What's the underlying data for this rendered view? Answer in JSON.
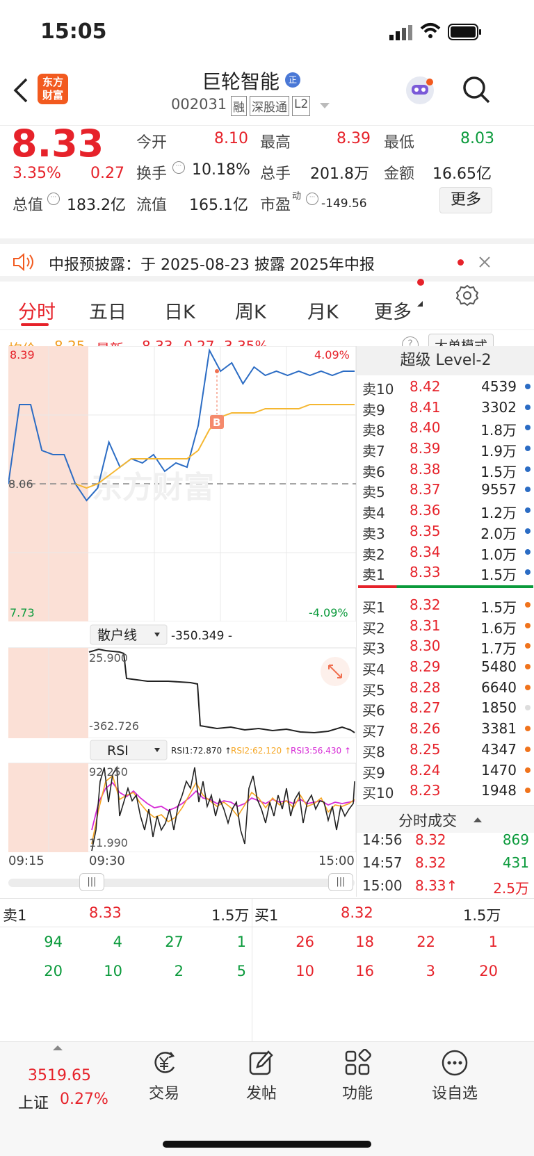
{
  "status": {
    "time": "15:05"
  },
  "header": {
    "logo_line1": "东方",
    "logo_line2": "财富",
    "stock_name": "巨轮智能",
    "stock_code": "002031",
    "tags": [
      "融",
      "深股通",
      "L2"
    ]
  },
  "quote": {
    "price": "8.33",
    "change_pct": "3.35%",
    "change": "0.27",
    "open_label": "今开",
    "open": "8.10",
    "high_label": "最高",
    "high": "8.39",
    "low_label": "最低",
    "low": "8.03",
    "turnover_label": "换手",
    "turnover": "10.18%",
    "volume_label": "总手",
    "volume": "201.8万",
    "amount_label": "金额",
    "amount": "16.65亿",
    "mktcap_label": "总值",
    "mktcap": "183.2亿",
    "float_label": "流值",
    "float": "165.1亿",
    "pe_label": "市盈",
    "pe_sup": "动",
    "pe": "-149.56",
    "more_button": "更多"
  },
  "notice": {
    "text": "中报预披露：于 2025-08-23 披露 2025年中报"
  },
  "tabs": [
    "分时",
    "五日",
    "日K",
    "周K",
    "月K",
    "更多"
  ],
  "info": {
    "avg_label": "均价:",
    "avg": "8.25",
    "latest_label": "最新:",
    "latest": "8.33",
    "latest_chg": "0.27",
    "latest_pct": "3.35%",
    "mode_button": "大单模式"
  },
  "chart": {
    "top_price": "8.39",
    "bottom_price": "7.73",
    "pre_close": "8.06",
    "top_pct": "4.09%",
    "bottom_pct": "-4.09%",
    "watermark": "东方财富",
    "buy_marker": "B",
    "retail_label": "散户线",
    "retail_value": "-350.349 -",
    "retail_top": "25.900",
    "retail_bottom": "-362.726",
    "rsi_label": "RSI",
    "rsi1": "RSI1:72.870 ↑",
    "rsi2": "RSI2:62.120 ↑",
    "rsi3": "RSI3:56.430 ↑",
    "rsi_top": "92.250",
    "rsi_bottom": "11.990",
    "time_start": "09:15",
    "time_open": "09:30",
    "time_end": "15:00"
  },
  "chart_data": {
    "type": "line",
    "title": "",
    "xlabel": "",
    "ylabel": "",
    "x_ticks": [
      "09:15",
      "09:30",
      "15:00"
    ],
    "ylim": [
      7.73,
      8.39
    ],
    "pre_close": 8.06,
    "series": [
      {
        "name": "",
        "values": [
          8.06,
          8.25,
          8.25,
          8.14,
          8.13,
          8.13,
          8.06,
          8.02,
          8.05,
          8.16,
          8.1,
          8.12,
          8.11,
          8.13,
          8.09,
          8.11,
          8.1,
          8.2,
          8.38,
          8.33,
          8.35,
          8.3,
          8.34,
          8.32,
          8.33,
          8.32,
          8.33,
          8.32,
          8.33,
          8.32,
          8.33,
          8.33
        ]
      },
      {
        "name": "均价",
        "values": [
          null,
          null,
          null,
          null,
          null,
          null,
          8.06,
          8.05,
          8.06,
          8.08,
          8.1,
          8.12,
          8.12,
          8.12,
          8.12,
          8.12,
          8.12,
          8.14,
          8.19,
          8.22,
          8.23,
          8.23,
          8.23,
          8.24,
          8.24,
          8.24,
          8.24,
          8.25,
          8.25,
          8.25,
          8.25,
          8.25
        ]
      }
    ]
  },
  "orderbook": {
    "title": "超级 Level-2",
    "asks": [
      {
        "label": "卖10",
        "price": "8.42",
        "vol": "4539"
      },
      {
        "label": "卖9",
        "price": "8.41",
        "vol": "3302"
      },
      {
        "label": "卖8",
        "price": "8.40",
        "vol": "1.8万"
      },
      {
        "label": "卖7",
        "price": "8.39",
        "vol": "1.9万"
      },
      {
        "label": "卖6",
        "price": "8.38",
        "vol": "1.5万"
      },
      {
        "label": "卖5",
        "price": "8.37",
        "vol": "9557"
      },
      {
        "label": "卖4",
        "price": "8.36",
        "vol": "1.2万"
      },
      {
        "label": "卖3",
        "price": "8.35",
        "vol": "2.0万"
      },
      {
        "label": "卖2",
        "price": "8.34",
        "vol": "1.0万"
      },
      {
        "label": "卖1",
        "price": "8.33",
        "vol": "1.5万"
      }
    ],
    "bids": [
      {
        "label": "买1",
        "price": "8.32",
        "vol": "1.5万"
      },
      {
        "label": "买2",
        "price": "8.31",
        "vol": "1.6万"
      },
      {
        "label": "买3",
        "price": "8.30",
        "vol": "1.7万"
      },
      {
        "label": "买4",
        "price": "8.29",
        "vol": "5480"
      },
      {
        "label": "买5",
        "price": "8.28",
        "vol": "6640"
      },
      {
        "label": "买6",
        "price": "8.27",
        "vol": "1850"
      },
      {
        "label": "买7",
        "price": "8.26",
        "vol": "3381"
      },
      {
        "label": "买8",
        "price": "8.25",
        "vol": "4347"
      },
      {
        "label": "买9",
        "price": "8.24",
        "vol": "1470"
      },
      {
        "label": "买10",
        "price": "8.23",
        "vol": "1948"
      }
    ],
    "trades_title": "分时成交",
    "trades": [
      {
        "time": "14:56",
        "price": "8.32",
        "vol": "869"
      },
      {
        "time": "14:57",
        "price": "8.32",
        "vol": "431"
      },
      {
        "time": "15:00",
        "price": "8.33↑",
        "vol": "2.5万"
      }
    ]
  },
  "queue": {
    "ask_label": "卖1",
    "ask_price": "8.33",
    "ask_vol": "1.5万",
    "bid_label": "买1",
    "bid_price": "8.32",
    "bid_vol": "1.5万",
    "ask_row1": [
      "94",
      "4",
      "27",
      "1"
    ],
    "ask_row2": [
      "20",
      "10",
      "2",
      "5"
    ],
    "bid_row1": [
      "26",
      "18",
      "22",
      "1"
    ],
    "bid_row2": [
      "10",
      "16",
      "3",
      "20"
    ]
  },
  "bottom": {
    "index_value": "3519.65",
    "index_name": "上证",
    "index_pct": "0.27%",
    "nav": [
      "交易",
      "发帖",
      "功能",
      "设自选"
    ]
  }
}
